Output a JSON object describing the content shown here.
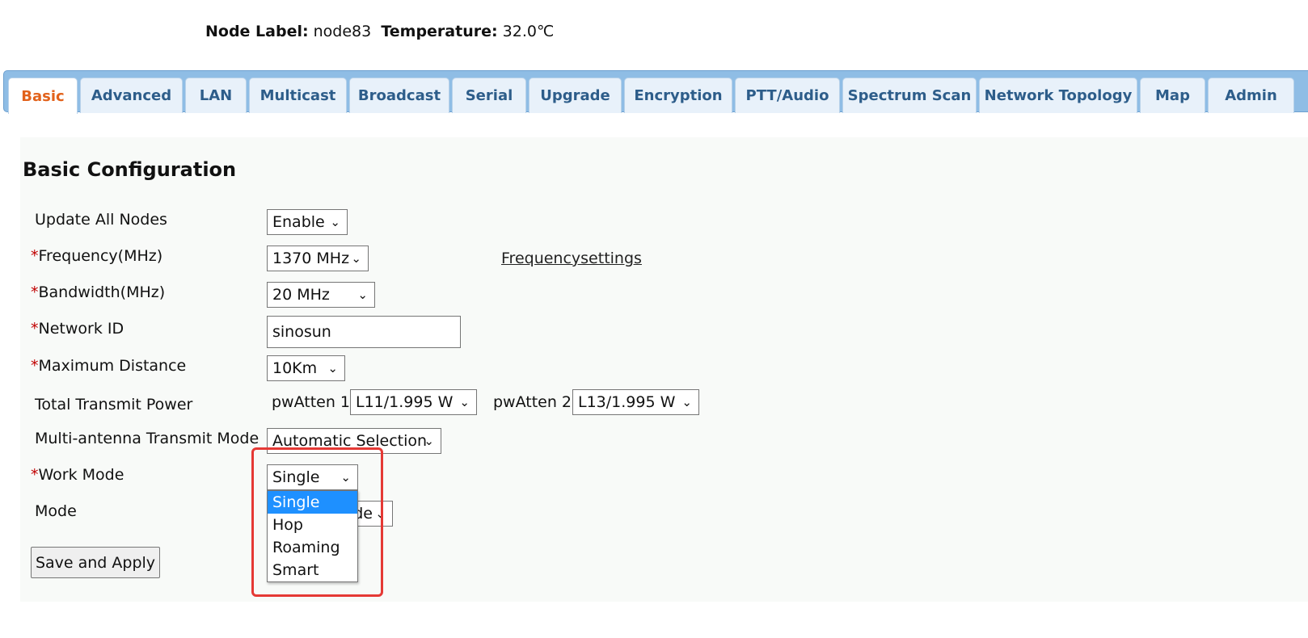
{
  "header": {
    "node_label_key": "Node Label:",
    "node_label_value": "node83",
    "temperature_key": "Temperature:",
    "temperature_value": "32.0℃"
  },
  "tabs": [
    "Basic",
    "Advanced",
    "LAN",
    "Multicast",
    "Broadcast",
    "Serial",
    "Upgrade",
    "Encryption",
    "PTT/Audio",
    "Spectrum Scan",
    "Network Topology",
    "Map",
    "Admin"
  ],
  "active_tab": "Basic",
  "form": {
    "title": "Basic Configuration",
    "update_all_nodes": {
      "label": "Update All Nodes",
      "value": "Enable"
    },
    "frequency": {
      "label": "Frequency(MHz)",
      "value": "1370 MHz",
      "link": "Frequencysettings"
    },
    "bandwidth": {
      "label": "Bandwidth(MHz)",
      "value": "20 MHz"
    },
    "network_id": {
      "label": "Network ID",
      "value": "sinosun"
    },
    "max_distance": {
      "label": "Maximum Distance",
      "value": "10Km"
    },
    "transmit_power": {
      "label": "Total Transmit Power",
      "pw1_label": "pwAtten 1",
      "pw1_value": "L11/1.995 W",
      "pw2_label": "pwAtten 2",
      "pw2_value": "L13/1.995 W"
    },
    "antenna_mode": {
      "label": "Multi-antenna Transmit Mode",
      "value": "Automatic Selection"
    },
    "work_mode": {
      "label": "Work Mode",
      "value": "Single",
      "options": [
        "Single",
        "Hop",
        "Roaming",
        "Smart"
      ],
      "highlighted": "Single"
    },
    "mode": {
      "label": "Mode",
      "value_fragment": "de"
    },
    "required_marker": "*",
    "save_label": "Save and Apply"
  },
  "colors": {
    "tab_bar": "#8fbde5",
    "tab_text": "#2d5d8a",
    "active_tab_text": "#e2621b",
    "required": "#c00000",
    "highlight": "#1e90ff",
    "annotation": "#e53935"
  },
  "icons": {
    "select_chevron": "chevron-down-icon"
  }
}
